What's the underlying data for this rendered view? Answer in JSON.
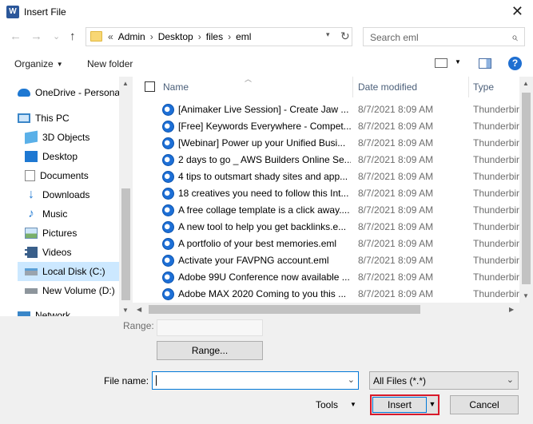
{
  "window": {
    "title": "Insert File",
    "app_icon": "W",
    "close_glyph": "✕"
  },
  "nav": {
    "back": "←",
    "forward": "→",
    "recent": "⌄",
    "up": "↑",
    "breadcrumb": [
      "Admin",
      "Desktop",
      "files",
      "eml"
    ],
    "overflow": "«",
    "search_placeholder": "Search eml"
  },
  "toolbar": {
    "organize": "Organize",
    "new_folder": "New folder",
    "help": "?"
  },
  "sidebar": {
    "items": [
      {
        "label": "OneDrive - Personal",
        "icon": "cloud-icon"
      },
      {
        "label": "This PC",
        "icon": "computer-icon"
      },
      {
        "label": "3D Objects",
        "icon": "cube-icon"
      },
      {
        "label": "Desktop",
        "icon": "desktop-icon"
      },
      {
        "label": "Documents",
        "icon": "document-icon"
      },
      {
        "label": "Downloads",
        "icon": "download-icon"
      },
      {
        "label": "Music",
        "icon": "music-icon"
      },
      {
        "label": "Pictures",
        "icon": "pictures-icon"
      },
      {
        "label": "Videos",
        "icon": "video-icon"
      },
      {
        "label": "Local Disk (C:)",
        "icon": "disk-icon",
        "selected": true
      },
      {
        "label": "New Volume (D:)",
        "icon": "drive-icon"
      },
      {
        "label": "Network",
        "icon": "network-icon"
      }
    ]
  },
  "columns": {
    "name": "Name",
    "date": "Date modified",
    "type": "Type"
  },
  "files": [
    {
      "name": "[Animaker Live Session] - Create Jaw ...",
      "date": "8/7/2021 8:09 AM",
      "type": "Thunderbird"
    },
    {
      "name": "[Free] Keywords Everywhere - Compet...",
      "date": "8/7/2021 8:09 AM",
      "type": "Thunderbird"
    },
    {
      "name": "[Webinar] Power up your Unified Busi...",
      "date": "8/7/2021 8:09 AM",
      "type": "Thunderbird"
    },
    {
      "name": "2 days to go _ AWS Builders Online Se...",
      "date": "8/7/2021 8:09 AM",
      "type": "Thunderbird"
    },
    {
      "name": "4 tips to outsmart shady sites and app...",
      "date": "8/7/2021 8:09 AM",
      "type": "Thunderbird"
    },
    {
      "name": "18 creatives you need to follow this Int...",
      "date": "8/7/2021 8:09 AM",
      "type": "Thunderbird"
    },
    {
      "name": "A free collage template is a click away....",
      "date": "8/7/2021 8:09 AM",
      "type": "Thunderbird"
    },
    {
      "name": "A new tool to help you get backlinks.e...",
      "date": "8/7/2021 8:09 AM",
      "type": "Thunderbird"
    },
    {
      "name": "A portfolio of your best memories.eml",
      "date": "8/7/2021 8:09 AM",
      "type": "Thunderbird"
    },
    {
      "name": "Activate your FAVPNG account.eml",
      "date": "8/7/2021 8:09 AM",
      "type": "Thunderbird"
    },
    {
      "name": "Adobe 99U Conference now available ...",
      "date": "8/7/2021 8:09 AM",
      "type": "Thunderbird"
    },
    {
      "name": "Adobe MAX 2020 Coming to you this ...",
      "date": "8/7/2021 8:09 AM",
      "type": "Thunderbird"
    }
  ],
  "bottom": {
    "range_label": "Range:",
    "range_button": "Range...",
    "file_name_label": "File name:",
    "file_name_value": "",
    "file_type": "All Files (*.*)",
    "tools": "Tools",
    "insert": "Insert",
    "cancel": "Cancel"
  }
}
